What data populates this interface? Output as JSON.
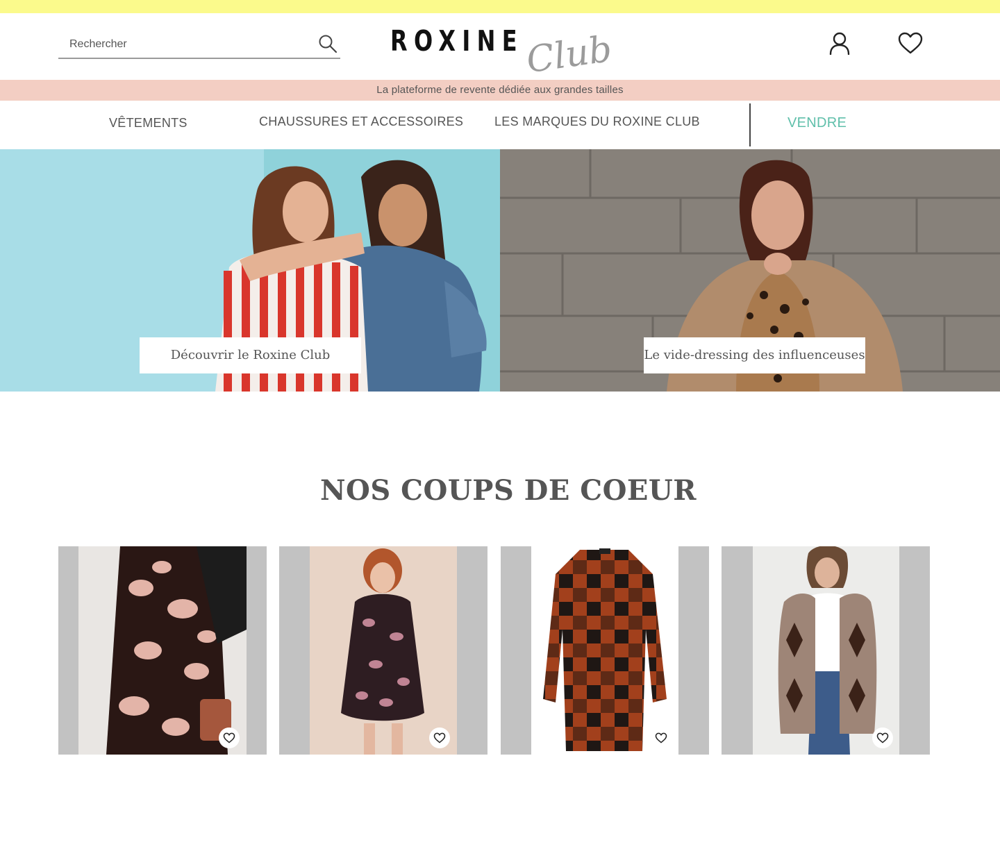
{
  "search": {
    "placeholder": "Rechercher"
  },
  "logo": {
    "word": "ROXINE",
    "script": "Club"
  },
  "tagline": "La plateforme de revente dédiée aux grandes tailles",
  "nav": {
    "items": [
      {
        "label": "VÊTEMENTS"
      },
      {
        "label": "CHAUSSURES ET ACCESSOIRES"
      },
      {
        "label": "LES MARQUES DU ROXINE CLUB"
      }
    ],
    "sell": "VENDRE"
  },
  "heroes": [
    {
      "cta": "Découvrir le Roxine Club"
    },
    {
      "cta": "Le vide-dressing des influenceuses"
    }
  ],
  "favorites": {
    "title": "NOS COUPS DE COEUR",
    "products": [
      {
        "icon": "heart-icon"
      },
      {
        "icon": "heart-icon"
      },
      {
        "icon": "heart-icon"
      },
      {
        "icon": "heart-icon"
      }
    ]
  },
  "colors": {
    "top_strip": "#fbfa8c",
    "tagline_bg": "#f3cec3",
    "sell_accent": "#5fbfaa",
    "card_bg": "#c2c2c2"
  }
}
